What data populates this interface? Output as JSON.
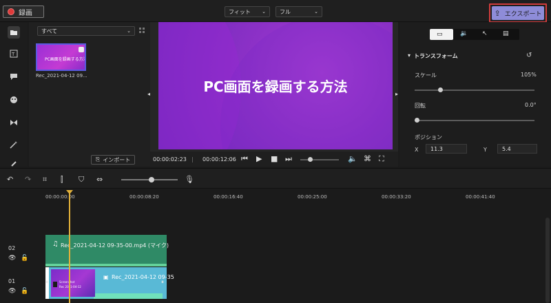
{
  "colors": {
    "accent_purple": "#8e8cd8",
    "record_red": "#e03a3a",
    "highlight_red": "#d23c3c",
    "playhead": "#e3b13a",
    "audio_track": "#2f8a66",
    "video_track": "#59b9d6",
    "selection_blue": "#5a5ae0"
  },
  "topbar": {
    "record_label": "録画",
    "fit_select": "フィット",
    "full_select": "フル",
    "export_label": "エクスポート"
  },
  "media": {
    "filter": "すべて",
    "item_name": "Rec_2021-04-12 09...",
    "thumb_text": "PC画面を録画する方法",
    "import_label": "インポート"
  },
  "preview": {
    "title": "PC画面を録画する方法",
    "time_current": "00:00:02:23",
    "separator": "|",
    "time_total": "00:00:12:06"
  },
  "properties": {
    "section": "トランスフォーム",
    "scale_label": "スケール",
    "scale_value": "105%",
    "rotate_label": "回転",
    "rotate_value": "0.0°",
    "position_label": "ポジション",
    "x_label": "X",
    "x_value": "11.3",
    "y_label": "Y",
    "y_value": "5.4"
  },
  "timeline": {
    "ruler": [
      "00:00:00:00",
      "00:00:08:20",
      "00:00:16:40",
      "00:00:25:00",
      "00:00:33:20",
      "00:00:41:40"
    ],
    "track2_number": "02",
    "track2_clip": "Rec_2021-04-12 09-35-00.mp4 (マイク)",
    "track1_number": "01",
    "track1_clip": "Rec_2021-04-12 09-35",
    "track1_thumb_text": "Screenshot",
    "track1_thumb_sub": "Rec 2021-04-12"
  },
  "icons": {
    "folder": "folder-icon",
    "text": "text-icon",
    "caption": "caption-icon",
    "sticker": "sticker-icon",
    "transition": "transition-icon",
    "effect": "magic-wand-icon",
    "cursor": "cursor-icon"
  }
}
